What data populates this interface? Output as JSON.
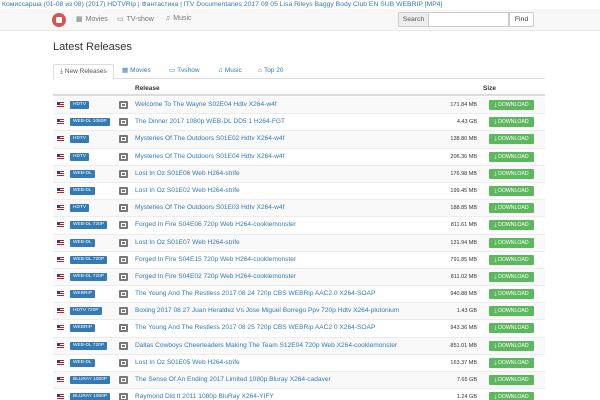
{
  "ticker": "Комиссарша (01-08 из 08) (2017) HDTVRip | Фантастика | ITV Documentaries 2017 09 05 Lisa Rileys Baggy Body Club EN SUB WEBRIP [MP4]",
  "nav": {
    "movies": "Movies",
    "tvshow": "TV-show",
    "music": "Music"
  },
  "search": {
    "label": "Search",
    "value": "",
    "placeholder": "",
    "button": "Find"
  },
  "page_title": "Latest Releases",
  "tabs": [
    {
      "label": "New Releases",
      "icon": "download-icon",
      "active": true
    },
    {
      "label": "Movies",
      "icon": "film-icon",
      "active": false
    },
    {
      "label": "Tvshow",
      "icon": "tv-icon",
      "active": false
    },
    {
      "label": "Music",
      "icon": "music-icon",
      "active": false
    },
    {
      "label": "Top 20",
      "icon": "tag-icon",
      "active": false
    }
  ],
  "table": {
    "headers": {
      "release": "Release",
      "size": "Size"
    },
    "download_label": "DOWNLOAD",
    "rows": [
      {
        "tag": "HDTV",
        "release": "Welcome To The Wayne S02E04 Hdtv X264-w4f",
        "size": "171.84 MB"
      },
      {
        "tag": "WEB-DL 1080P",
        "release": "The Dinner 2017 1080p WEB-DL DD5 1 H264-FGT",
        "size": "4.43 GB"
      },
      {
        "tag": "HDTV",
        "release": "Mysteries Of The Outdoors S01E02 Hdtv X264-w4f",
        "size": "138.80 MB"
      },
      {
        "tag": "HDTV",
        "release": "Mysteries Of The Outdoors S01E04 Hdtv X264-w4f",
        "size": "206.36 MB"
      },
      {
        "tag": "WEB-DL",
        "release": "Lost In Oz S01E06 Web H264-strife",
        "size": "176.98 MB"
      },
      {
        "tag": "WEB-DL",
        "release": "Lost In Oz S01E02 Web H264-strife",
        "size": "199.45 MB"
      },
      {
        "tag": "HDTV",
        "release": "Mysteries Of The Outdoors S01E03 Hdtv X264-w4f",
        "size": "188.85 MB"
      },
      {
        "tag": "WEB-DL 720P",
        "release": "Forged In Fire S04E06 720p Web H264-cooklemonster",
        "size": "811.61 MB"
      },
      {
        "tag": "WEB-DL",
        "release": "Lost In Oz S01E07 Web H264-strife",
        "size": "131.94 MB"
      },
      {
        "tag": "WEB-DL 720P",
        "release": "Forged In Fire S04E15 720p Web H264-cooklemonster",
        "size": "791.85 MB"
      },
      {
        "tag": "WEB-DL 720P",
        "release": "Forged In Fire S04E02 720p Web H264-cooklemonster",
        "size": "811.02 MB"
      },
      {
        "tag": "WEBRIP",
        "release": "The Young And The Restless 2017 08 24 720p CBS WEBRip AAC2 0 X264-SOAP",
        "size": "940.88 MB"
      },
      {
        "tag": "HDTV 720P",
        "release": "Boxing 2017 08 27 Juan Heraldez Vs Jose Miguel Borrego Ppv 720p Hdtv X264-plutonium",
        "size": "1.43 GB"
      },
      {
        "tag": "WEBRIP",
        "release": "The Young And The Restless 2017 08 25 720p CBS WEBRip AAC2 0 X264-SOAP",
        "size": "943.36 MB"
      },
      {
        "tag": "WEB-DL 720P",
        "release": "Dallas Cowboys Cheerleaders Making The Team S12E04 720p Web X264-cooklemonster",
        "size": "851.01 MB"
      },
      {
        "tag": "WEB-DL",
        "release": "Lost In Oz S01E05 Web H264-strife",
        "size": "163.37 MB"
      },
      {
        "tag": "BLURAY 1080P",
        "release": "The Sense Of An Ending 2017 Limited 1080p Bluray X264-cadaver",
        "size": "7.65 GB"
      },
      {
        "tag": "BLURAY 1080P",
        "release": "Raymond Did It 2011 1080p BluRay X264-YIFY",
        "size": "1.24 GB"
      }
    ]
  },
  "colors": {
    "link": "#337ab7",
    "download": "#5cb85c",
    "tag": "#337ab7",
    "logo": "#d9534f"
  }
}
